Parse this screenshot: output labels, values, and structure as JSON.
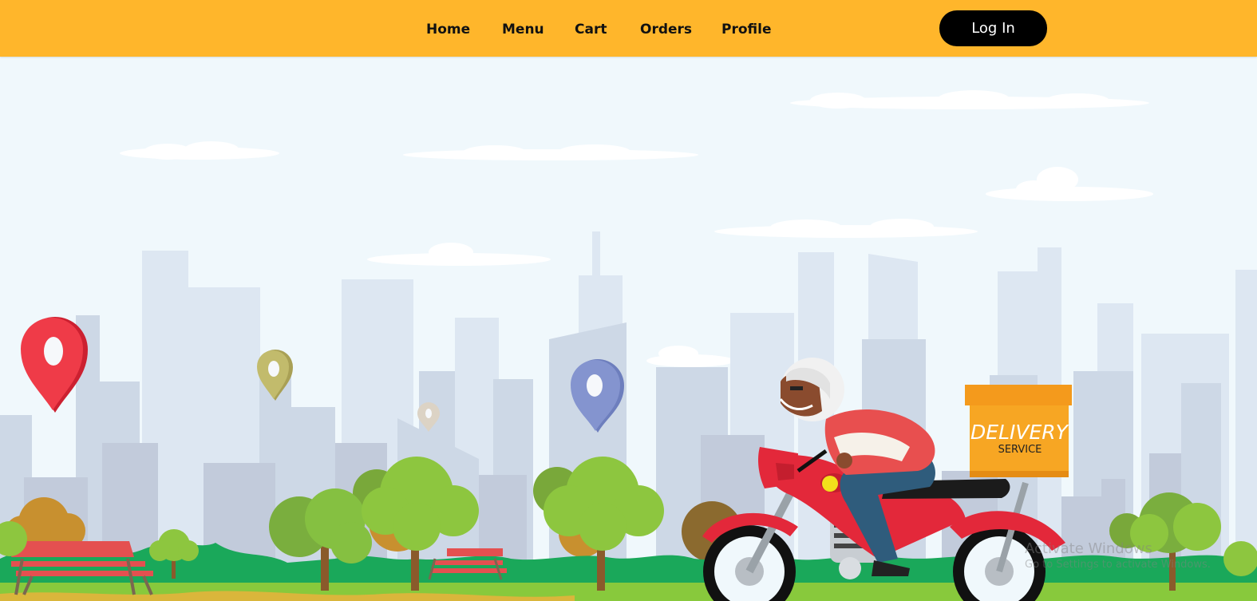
{
  "nav": {
    "items": [
      {
        "label": "Home"
      },
      {
        "label": "Menu"
      },
      {
        "label": "Cart"
      },
      {
        "label": "Orders"
      },
      {
        "label": "Profile"
      }
    ],
    "login_label": "Log In"
  },
  "hero": {
    "box_line1": "DELIVERY",
    "box_line2": "SERVICE"
  },
  "watermark": {
    "title": "Activate Windows",
    "subtitle": "Go to Settings to activate Windows."
  },
  "colors": {
    "navbar": "#ffb62b",
    "login_button": "#000000",
    "sky": "#f0f8fc",
    "grass": "#1aa85a",
    "pin_red": "#ef3b48",
    "pin_blue": "#8494cf",
    "bike_red": "#e3283a",
    "delivery_box": "#f7a623"
  },
  "icons": [
    "location-pin-icon"
  ]
}
